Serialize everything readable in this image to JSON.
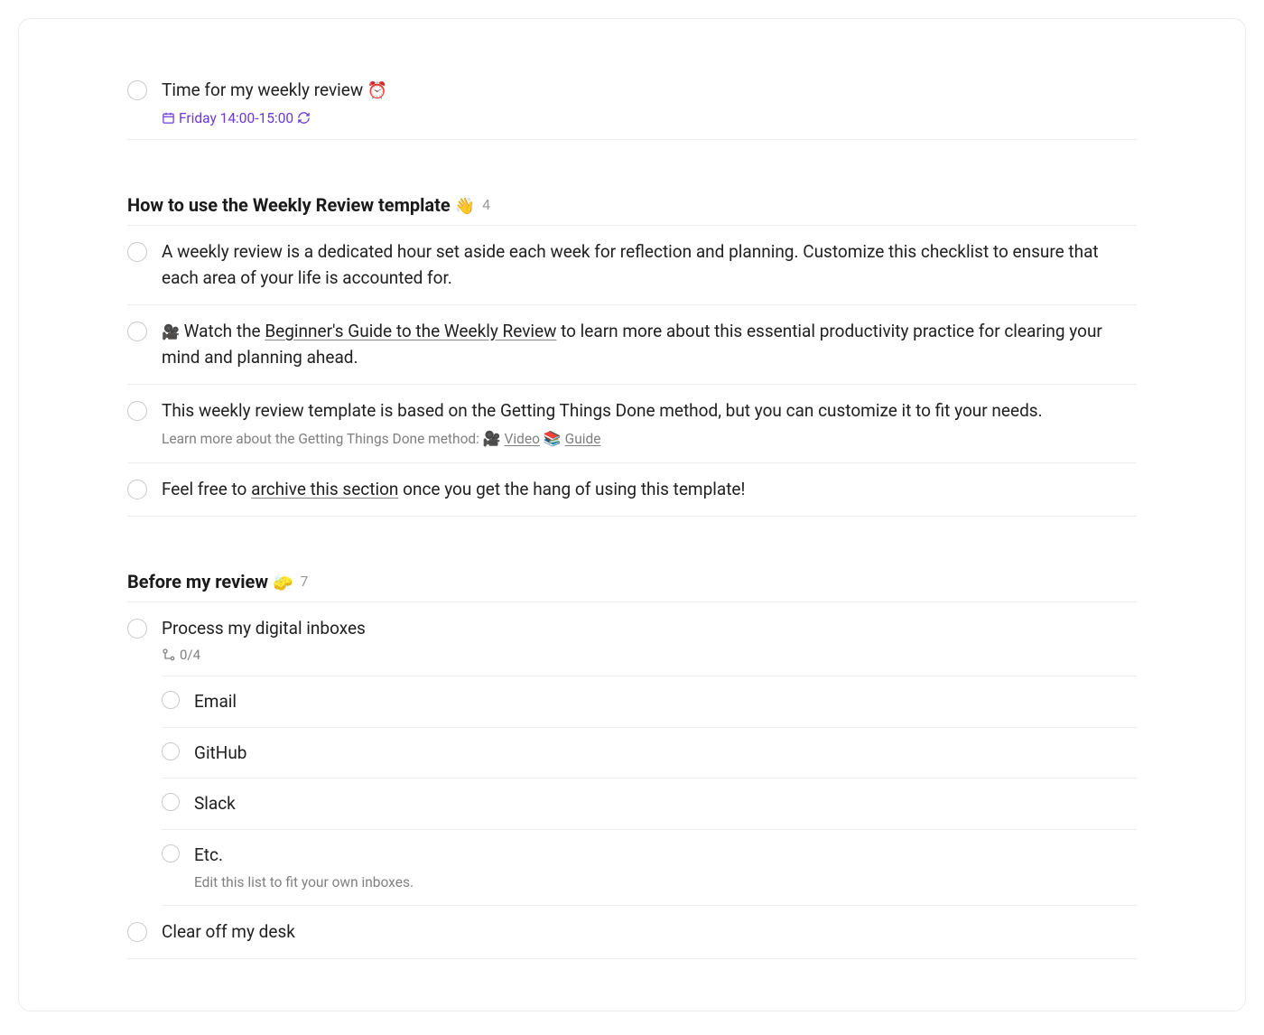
{
  "top_task": {
    "title": "Time for my weekly review",
    "emoji": "⏰",
    "schedule": "Friday 14:00-15:00"
  },
  "sections": [
    {
      "title": "How to use the Weekly Review template",
      "emoji": "👋",
      "count": "4",
      "items": [
        {
          "text": "A weekly review is a dedicated hour set aside each week for reflection and planning. Customize this checklist to ensure that each area of your life is accounted for."
        },
        {
          "prefix_emoji": "🎥",
          "text_before": " Watch the ",
          "link_text": "Beginner's Guide to the Weekly Review",
          "text_after": " to learn more about this essential productivity practice for clearing your mind and planning ahead."
        },
        {
          "text": "This weekly review template is based on the Getting Things Done method, but you can customize it to fit your needs.",
          "sub_before": "Learn more about the Getting Things Done method: ",
          "sub_e1": "🎥",
          "sub_link1": "Video",
          "sub_e2": "📚",
          "sub_link2": "Guide"
        },
        {
          "text_before": "Feel free to ",
          "link_text": "archive this section",
          "text_after": " once you get the hang of using this template!"
        }
      ]
    },
    {
      "title": "Before my review",
      "emoji": "🧽",
      "count": "7",
      "items": [
        {
          "text": "Process my digital inboxes",
          "progress": "0/4",
          "subtasks": [
            {
              "text": "Email"
            },
            {
              "text": "GitHub"
            },
            {
              "text": "Slack"
            },
            {
              "text": "Etc.",
              "sub": "Edit this list to fit your own inboxes."
            }
          ]
        },
        {
          "text": "Clear off my desk"
        }
      ]
    }
  ]
}
